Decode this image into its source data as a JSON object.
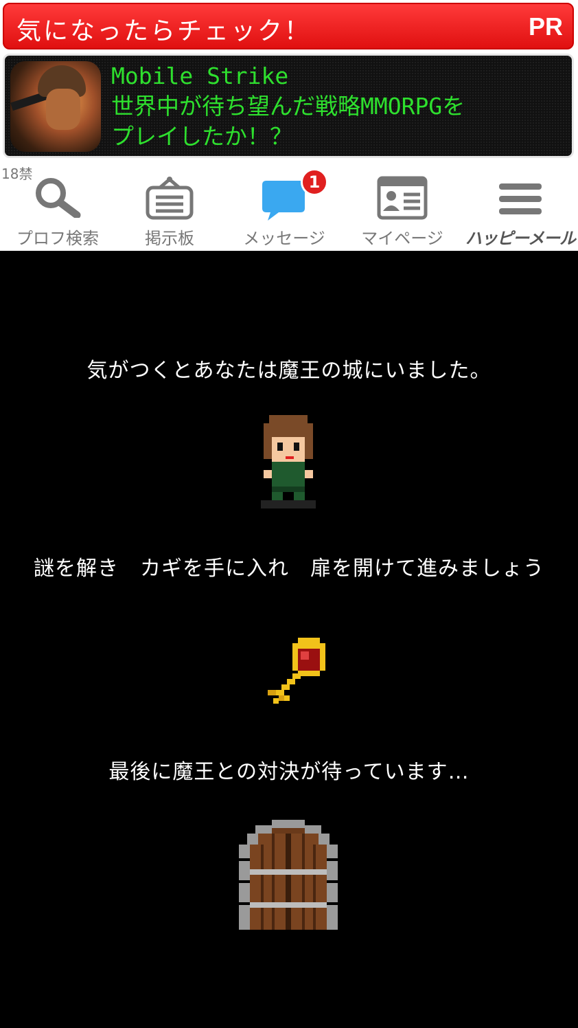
{
  "ad": {
    "banner_text": "気になったらチェック！",
    "pr_label": "PR",
    "title": "Mobile Strike",
    "line1": "世界中が待ち望んだ戦略MMORPGを",
    "line2": "プレイしたか！？"
  },
  "nav": {
    "age_label": "18禁",
    "items": [
      {
        "label": "プロフ検索",
        "icon": "search-icon"
      },
      {
        "label": "掲示板",
        "icon": "board-icon"
      },
      {
        "label": "メッセージ",
        "icon": "message-icon",
        "badge": "1"
      },
      {
        "label": "マイページ",
        "icon": "profile-card-icon"
      },
      {
        "label": "ハッピーメール",
        "icon": "menu-icon"
      }
    ]
  },
  "story": {
    "line1": "気がつくとあなたは魔王の城にいました。",
    "line2": "謎を解き　カギを手に入れ　扉を開けて進みましょう",
    "line3": "最後に魔王との対決が待っています…"
  },
  "colors": {
    "ad_red": "#e01010",
    "ad_green_text": "#2ee02e",
    "badge_red": "#e02020",
    "nav_icon_blue": "#3aa8f0"
  }
}
